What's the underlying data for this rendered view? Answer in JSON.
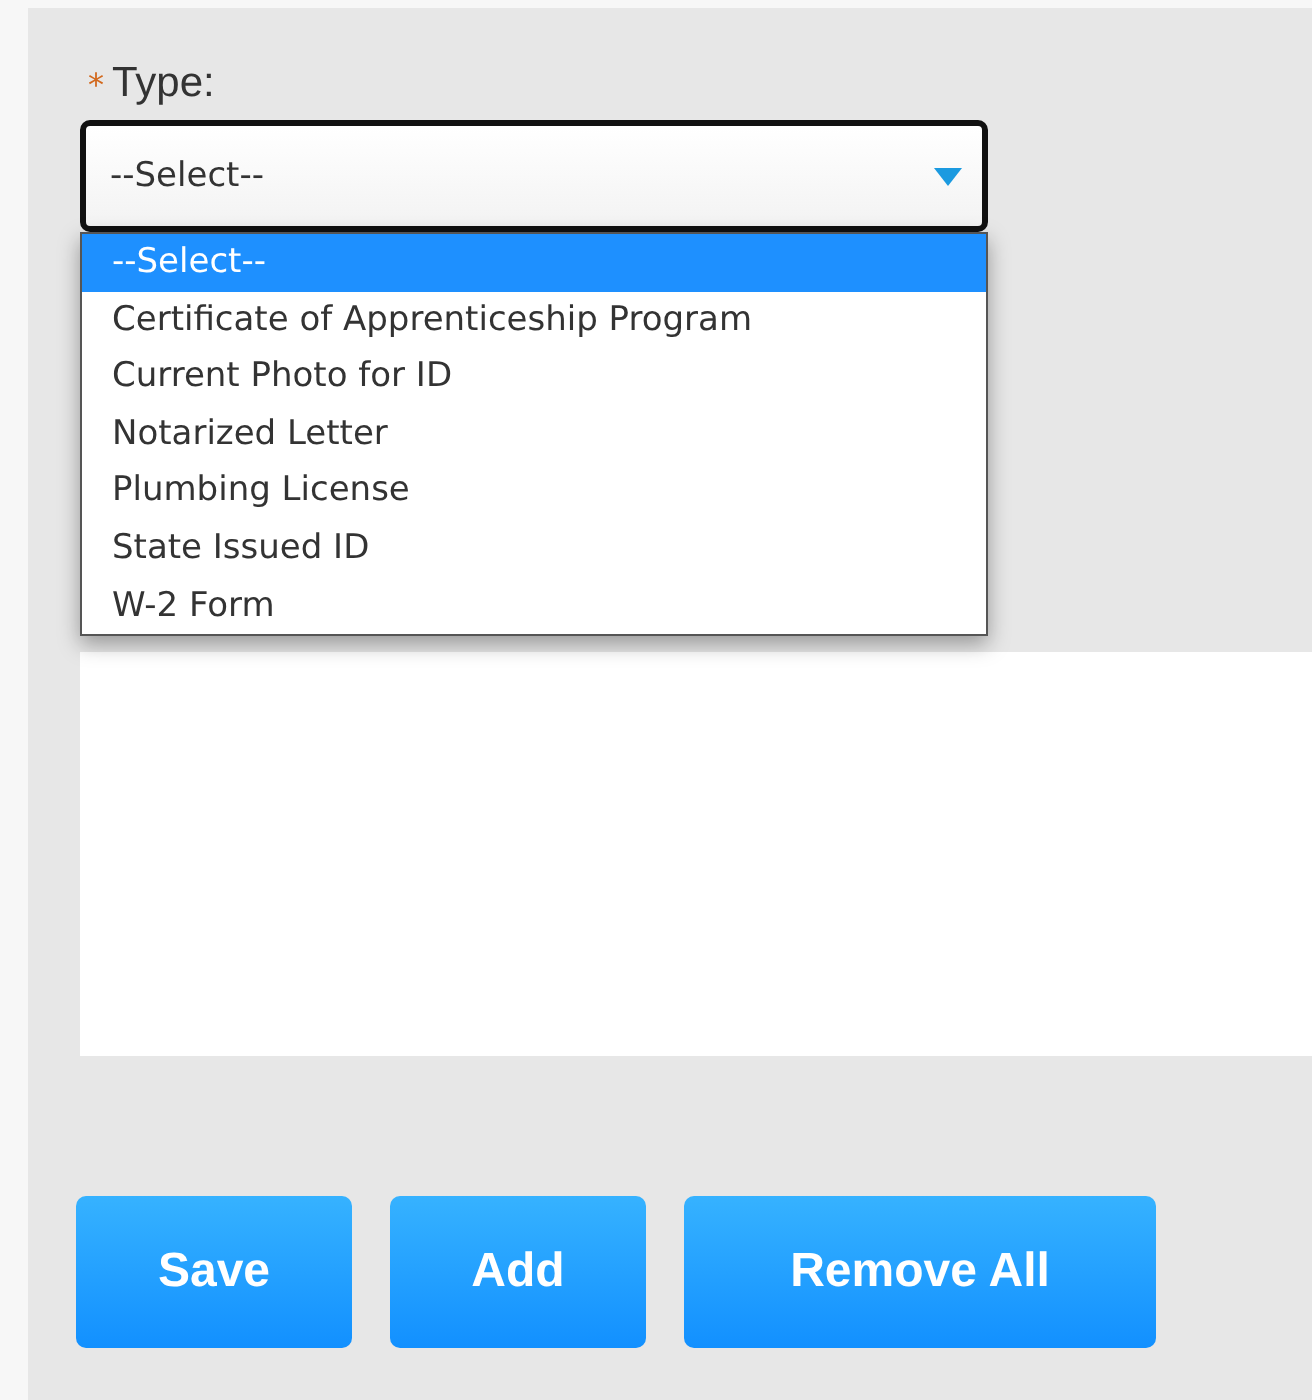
{
  "field": {
    "required_mark": "*",
    "label": "Type:",
    "value": "--Select--"
  },
  "dropdown": {
    "options": [
      {
        "label": "--Select--",
        "selected": true
      },
      {
        "label": "Certificate of Apprenticeship Program",
        "selected": false
      },
      {
        "label": "Current Photo for ID",
        "selected": false
      },
      {
        "label": "Notarized Letter",
        "selected": false
      },
      {
        "label": "Plumbing License",
        "selected": false
      },
      {
        "label": "State Issued ID",
        "selected": false
      },
      {
        "label": "W-2 Form",
        "selected": false
      }
    ]
  },
  "buttons": [
    "Save",
    "Add",
    "Remove All"
  ]
}
